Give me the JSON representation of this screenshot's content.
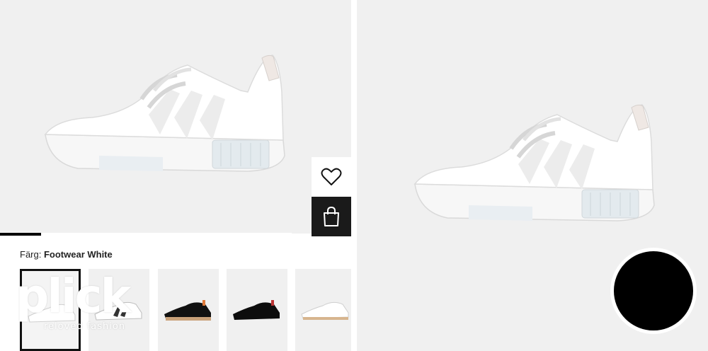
{
  "product": {
    "color_label": "Färg:",
    "color_value": "Footwear White"
  },
  "gallery": {
    "progress_fraction": 0.14,
    "thumbnails": [
      {
        "variant": "white",
        "selected": true
      },
      {
        "variant": "white-black",
        "selected": false
      },
      {
        "variant": "black-gum",
        "selected": false
      },
      {
        "variant": "black",
        "selected": false
      },
      {
        "variant": "white-gum",
        "selected": false
      }
    ]
  },
  "actions": {
    "favorite_icon": "heart-icon",
    "bag_icon": "shopping-bag-icon"
  },
  "watermark": {
    "word": "plick",
    "tagline": "reloved fashion"
  },
  "colors": {
    "background_gray": "#f0f0f0",
    "dark_button": "#1a1a1a",
    "accent_black": "#000000"
  }
}
